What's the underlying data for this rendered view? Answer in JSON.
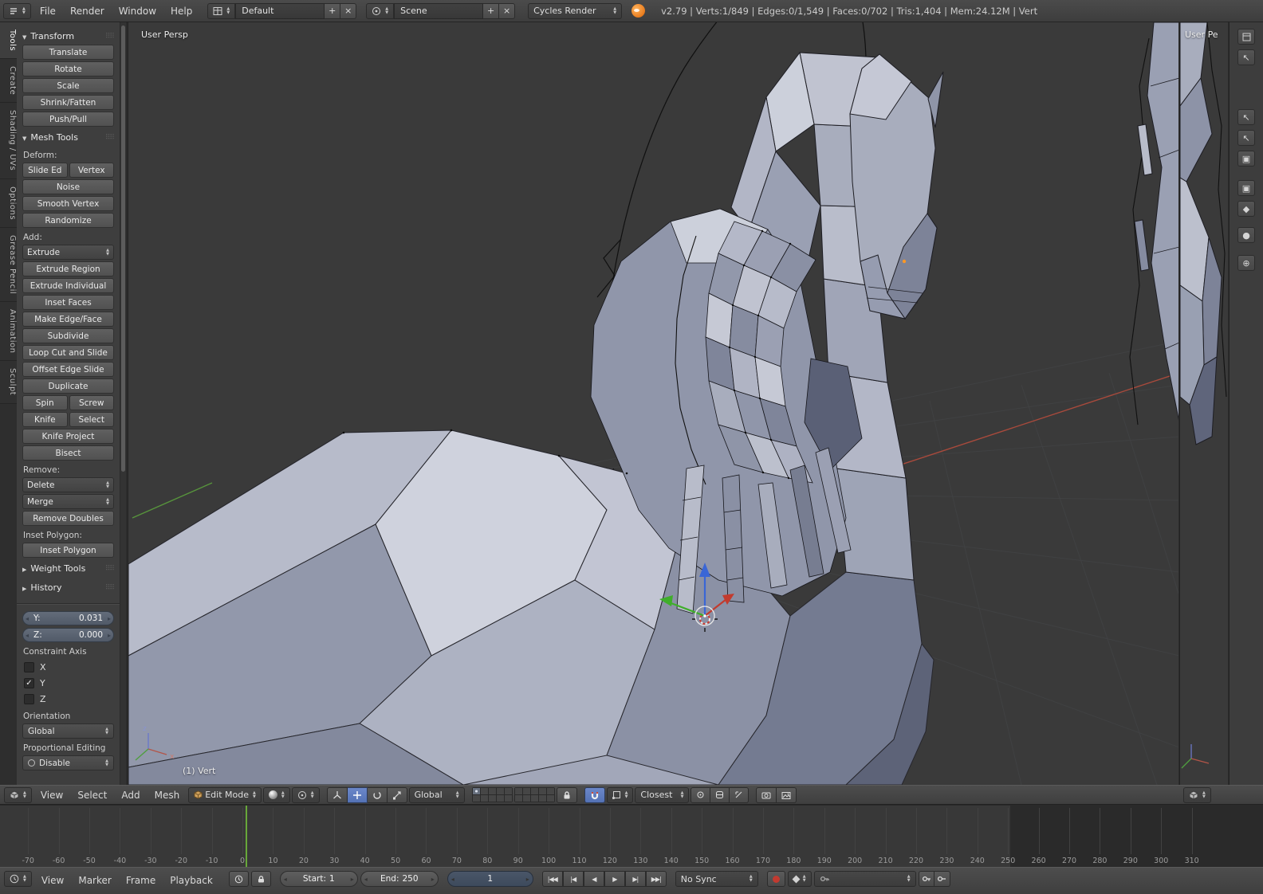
{
  "icons": {
    "plus": "+",
    "close": "×"
  },
  "top_header": {
    "menus": [
      "File",
      "Render",
      "Window",
      "Help"
    ],
    "layout_name": "Default",
    "scene_name": "Scene",
    "engine": "Cycles Render",
    "stats": "v2.79 | Verts:1/849 | Edges:0/1,549 | Faces:0/702 | Tris:1,404 | Mem:24.12M | Vert"
  },
  "tool_shelf": {
    "tabs": [
      "Tools",
      "Create",
      "Shading / UVs",
      "Options",
      "Grease Pencil",
      "Animation",
      "Sculpt"
    ],
    "transform": {
      "title": "Transform",
      "buttons": [
        "Translate",
        "Rotate",
        "Scale",
        "Shrink/Fatten",
        "Push/Pull"
      ]
    },
    "mesh_tools": {
      "title": "Mesh Tools",
      "deform_label": "Deform:",
      "deform_pair": [
        "Slide Ed",
        "Vertex"
      ],
      "deform_buttons": [
        "Noise",
        "Smooth Vertex",
        "Randomize"
      ],
      "add_label": "Add:",
      "extrude_dropdown": "Extrude",
      "add_buttons": [
        "Extrude Region",
        "Extrude Individual",
        "Inset Faces",
        "Make Edge/Face",
        "Subdivide",
        "Loop Cut and Slide",
        "Offset Edge Slide",
        "Duplicate"
      ],
      "pair_rows": [
        [
          "Spin",
          "Screw"
        ],
        [
          "Knife",
          "Select"
        ]
      ],
      "more_buttons": [
        "Knife Project",
        "Bisect"
      ],
      "remove_label": "Remove:",
      "remove_dropdowns": [
        "Delete",
        "Merge"
      ],
      "remove_button": "Remove Doubles",
      "inset_label": "Inset Polygon:",
      "inset_button": "Inset Polygon"
    },
    "collapsed_panels": [
      "Weight Tools",
      "History"
    ],
    "operator": {
      "fields": [
        {
          "label": "Y:",
          "value": "0.031"
        },
        {
          "label": "Z:",
          "value": "0.000"
        }
      ],
      "constraint_label": "Constraint Axis",
      "axes": [
        {
          "label": "X",
          "mark": ""
        },
        {
          "label": "Y",
          "mark": "✓"
        },
        {
          "label": "Z",
          "mark": ""
        }
      ],
      "orientation_label": "Orientation",
      "orientation_value": "Global",
      "proportional_label": "Proportional Editing",
      "proportional_value": "Disable"
    }
  },
  "viewport": {
    "view_label": "User Persp",
    "status_label": "(1) Vert",
    "axis_x": "x",
    "axis_z": "z"
  },
  "viewport_header": {
    "menus": [
      "View",
      "Select",
      "Add",
      "Mesh"
    ],
    "mode": "Edit Mode",
    "orientation": "Global",
    "snap_target": "Closest"
  },
  "right_panel": {
    "view_label": "User Pe",
    "tab_glyphs": [
      "↖",
      "↖",
      "↖",
      "▣",
      "▣",
      "◆",
      "●",
      "⊕"
    ]
  },
  "timeline": {
    "ticks": [
      -70,
      -60,
      -50,
      -40,
      -30,
      -20,
      -10,
      0,
      10,
      20,
      30,
      40,
      50,
      60,
      70,
      80,
      90,
      100,
      110,
      120,
      130,
      140,
      150,
      160,
      170,
      180,
      190,
      200,
      210,
      220,
      230,
      240,
      250,
      260,
      270,
      280,
      290,
      300,
      310
    ],
    "menus": [
      "View",
      "Marker",
      "Frame",
      "Playback"
    ],
    "start_label": "Start:",
    "start_value": "1",
    "end_label": "End:",
    "end_value": "250",
    "current_frame": "1",
    "sync": "No Sync",
    "playback": [
      "|◀◀",
      "|◀",
      "◀",
      "▶",
      "▶|",
      "▶▶|"
    ]
  }
}
